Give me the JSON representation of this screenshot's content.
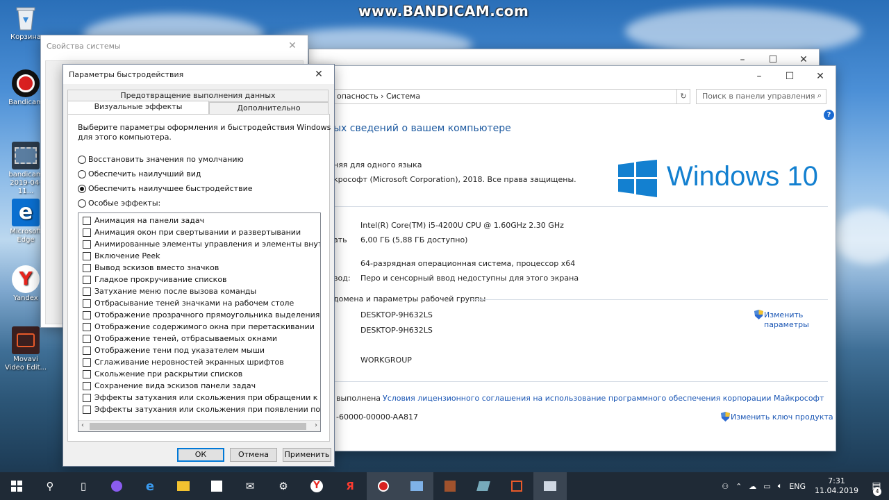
{
  "watermark": "www.BANDICAM.com",
  "desktop_icons": [
    {
      "label": "Корзина"
    },
    {
      "label": "Bandicam"
    },
    {
      "label": "bandicam 2019-04-11..."
    },
    {
      "label": "Microsoft Edge"
    },
    {
      "label": "Yandex"
    },
    {
      "label": "Movavi Video Edit..."
    }
  ],
  "system_properties": {
    "title": "Свойства системы"
  },
  "control_panel": {
    "breadcrumb": "опасность  ›  Система",
    "search_placeholder": "Поиск в панели управления",
    "heading": "ых сведений о вашем компьютере",
    "edition_line1": "няя для одного языка",
    "edition_line2": "крософт (Microsoft Corporation), 2018. Все права защищены.",
    "logo_text": "Windows 10",
    "processor": "Intel(R) Core(TM) i5-4200U CPU @ 1.60GHz   2.30 GHz",
    "ram_label": "ать",
    "ram": "6,00 ГБ (5,88 ГБ доступно)",
    "system_type": "64-разрядная операционная система, процессор x64",
    "pen_label": "вод:",
    "pen": "Перо и сенсорный ввод недоступны для этого экрана",
    "domain_section": "домена и параметры рабочей группы",
    "computer_name": "DESKTOP-9H632LS",
    "full_name": "DESKTOP-9H632LS",
    "workgroup": "WORKGROUP",
    "change_settings_line1": "Изменить",
    "change_settings_line2": "параметры",
    "activation_label": "выполнена",
    "license_link": "Условия лицензионного соглашения на использование программного обеспечения корпорации Майкрософт",
    "product_id": "-60000-00000-AA817",
    "change_key": "Изменить ключ продукта"
  },
  "performance_options": {
    "title": "Параметры быстродействия",
    "tabs": {
      "dep": "Предотвращение выполнения данных",
      "visual": "Визуальные эффекты",
      "advanced": "Дополнительно"
    },
    "intro_line1": "Выберите параметры оформления и быстродействия Windows",
    "intro_line2": "для этого компьютера.",
    "radios": [
      {
        "label": "Восстановить значения по умолчанию",
        "checked": false
      },
      {
        "label": "Обеспечить наилучший вид",
        "checked": false
      },
      {
        "label": "Обеспечить наилучшее быстродействие",
        "checked": true
      },
      {
        "label": "Особые эффекты:",
        "checked": false
      }
    ],
    "effects": [
      "Анимация на панели задач",
      "Анимация окон при свертывании и развертывании",
      "Анимированные элементы управления и элементы внутри окн",
      "Включение Peek",
      "Вывод эскизов вместо значков",
      "Гладкое прокручивание списков",
      "Затухание меню после вызова команды",
      "Отбрасывание теней значками на рабочем столе",
      "Отображение прозрачного прямоугольника выделения",
      "Отображение содержимого окна при перетаскивании",
      "Отображение теней, отбрасываемых окнами",
      "Отображение тени под указателем мыши",
      "Сглаживание неровностей экранных шрифтов",
      "Скольжение при раскрытии списков",
      "Сохранение вида эскизов панели задач",
      "Эффекты затухания или скольжения при обращении к меню",
      "Эффекты затухания или скольжения при появлении подсказок"
    ],
    "buttons": {
      "ok": "ОК",
      "cancel": "Отмена",
      "apply": "Применить"
    }
  },
  "taskbar": {
    "language": "ENG",
    "time": "7:31",
    "date": "11.04.2019",
    "notification_count": "4"
  }
}
